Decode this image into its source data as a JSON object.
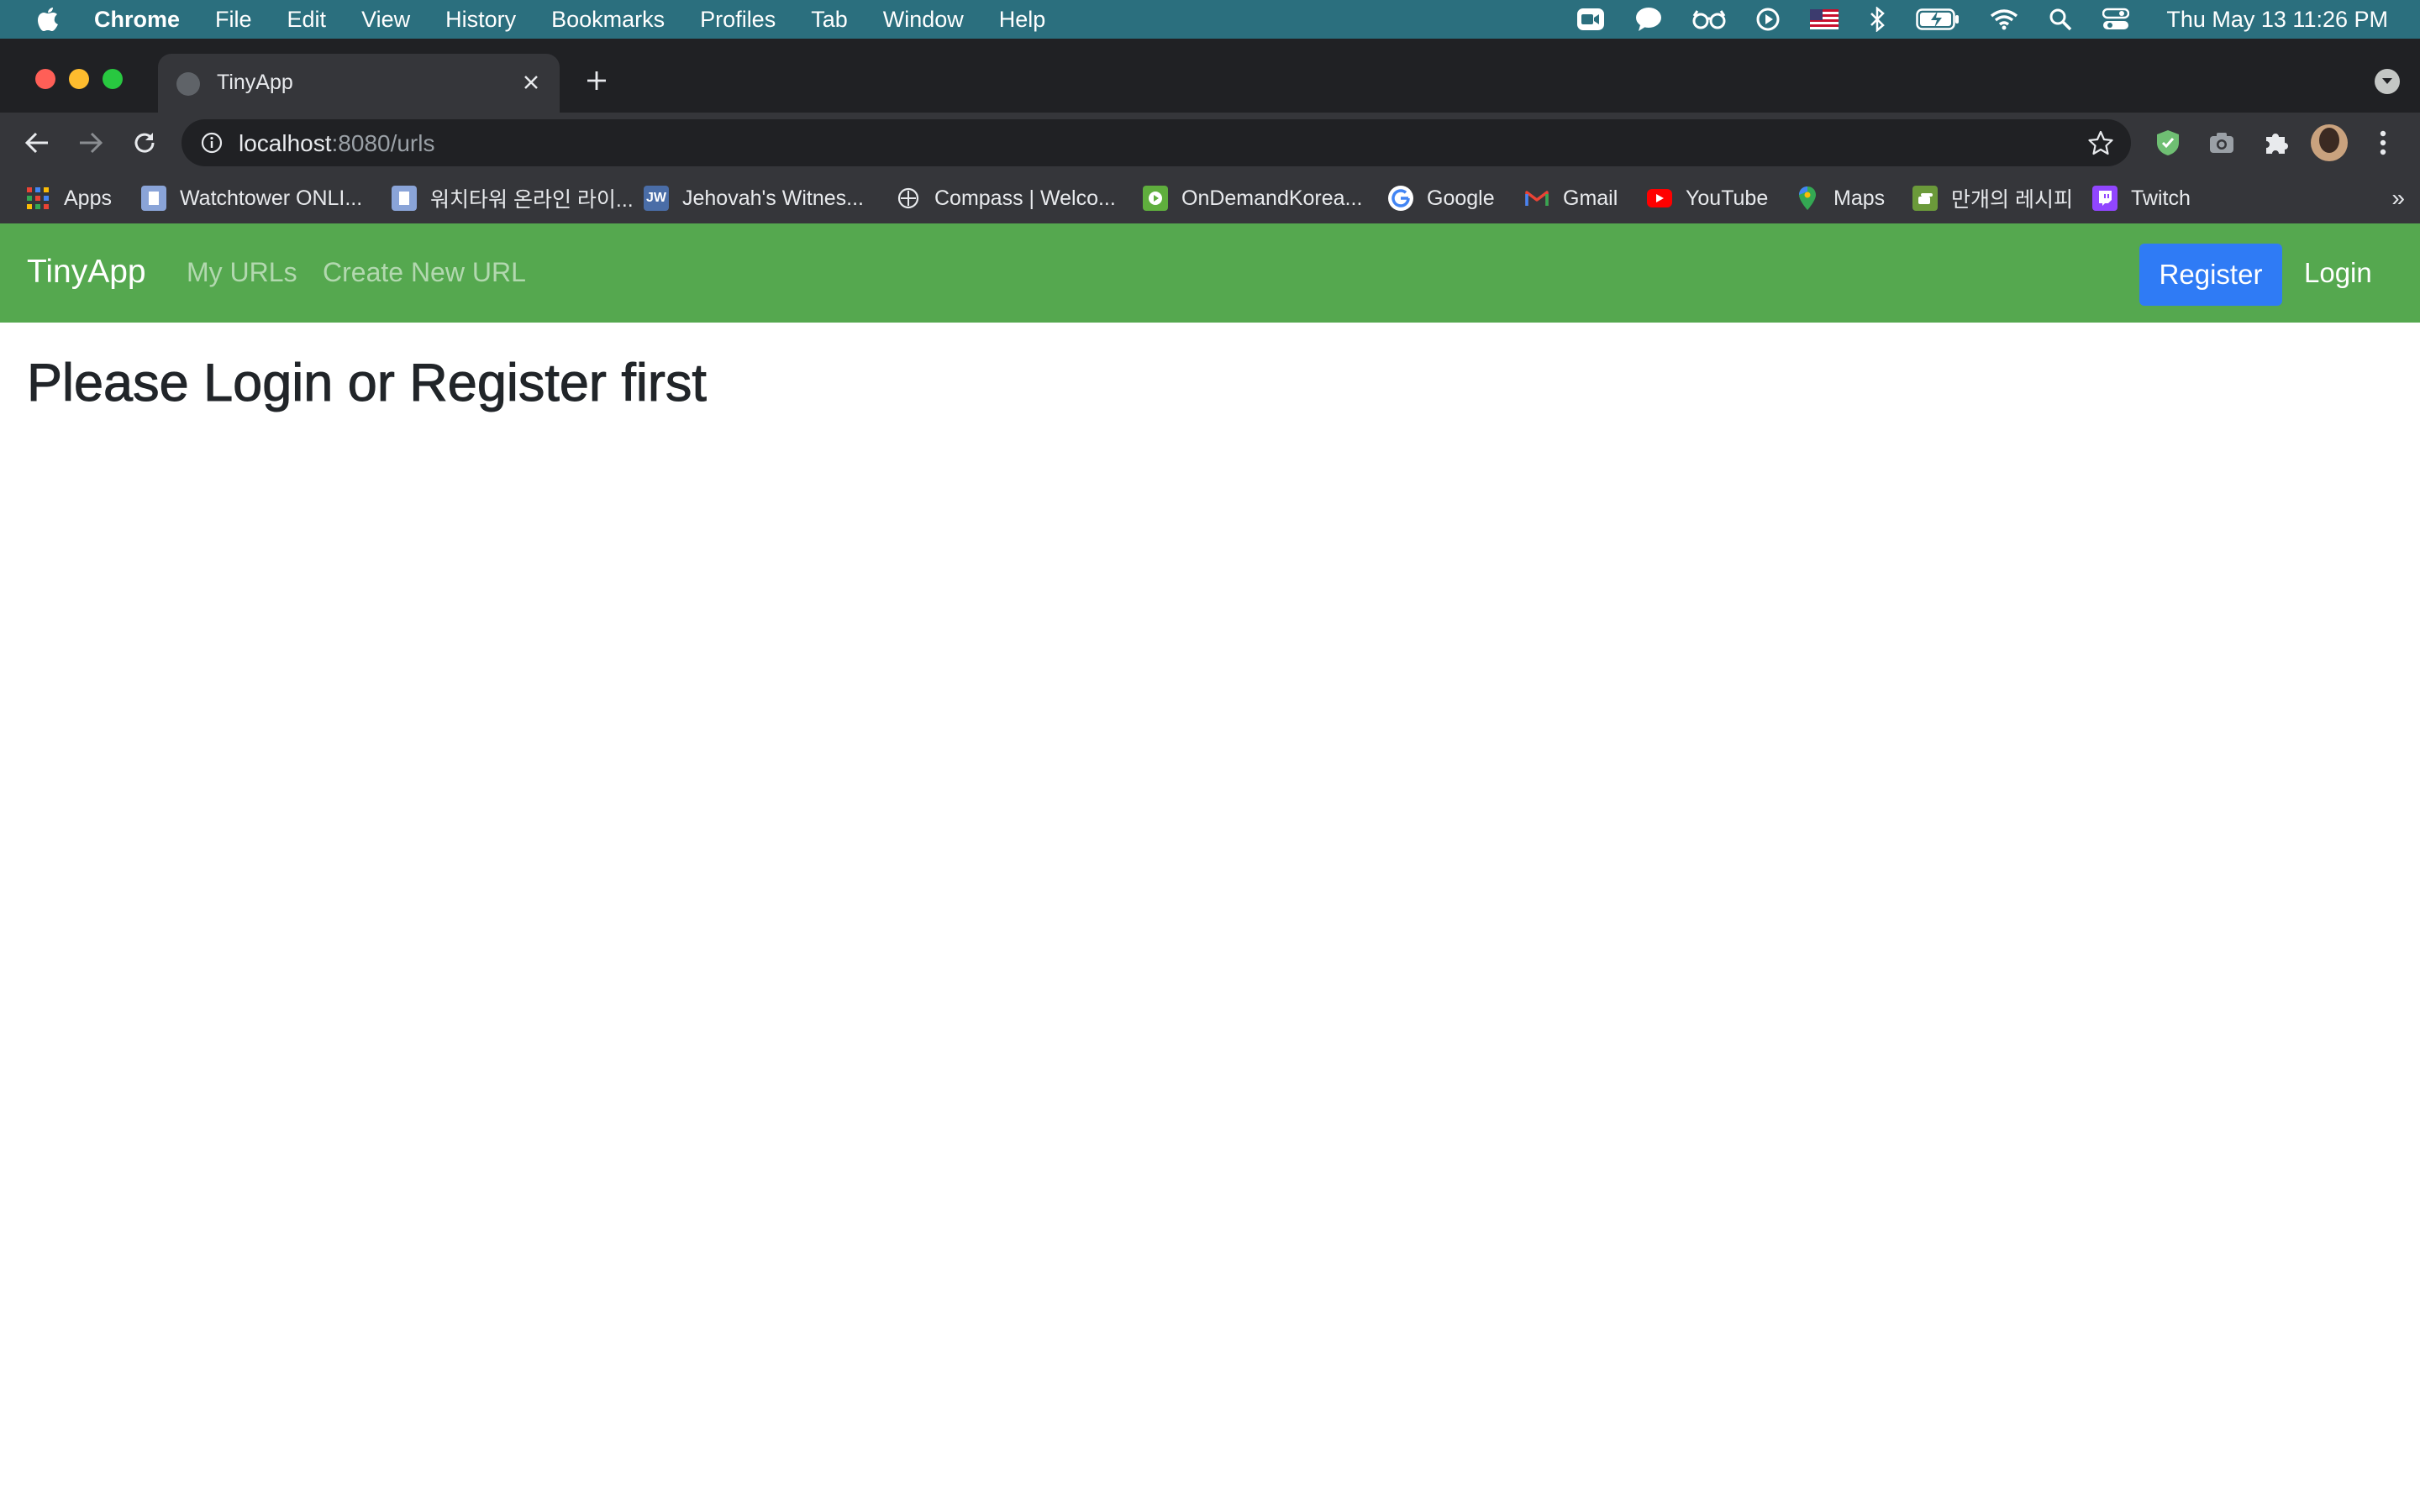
{
  "menubar": {
    "app_name": "Chrome",
    "items": [
      "File",
      "Edit",
      "View",
      "History",
      "Bookmarks",
      "Profiles",
      "Tab",
      "Window",
      "Help"
    ],
    "status_icons": [
      "zoom-icon",
      "messages-icon",
      "glasses-icon",
      "play-icon",
      "us-flag-icon",
      "bluetooth-icon",
      "battery-icon",
      "wifi-icon",
      "spotlight-icon",
      "control-center-icon"
    ],
    "clock": "Thu May 13  11:26 PM"
  },
  "browser": {
    "tab_title": "TinyApp",
    "url_host": "localhost",
    "url_rest": ":8080/urls",
    "bookmarks": [
      {
        "label": "Apps",
        "icon": "apps-grid-icon"
      },
      {
        "label": "Watchtower ONLI...",
        "icon": "watchtower-icon"
      },
      {
        "label": "워치타워 온라인 라이...",
        "icon": "watchtower-icon"
      },
      {
        "label": "Jehovah's Witnes...",
        "icon": "jw-icon",
        "icon_text": "JW"
      },
      {
        "label": "Compass | Welco...",
        "icon": "compass-icon"
      },
      {
        "label": "OnDemandKorea...",
        "icon": "ondemandkorea-icon"
      },
      {
        "label": "Google",
        "icon": "google-icon"
      },
      {
        "label": "Gmail",
        "icon": "gmail-icon"
      },
      {
        "label": "YouTube",
        "icon": "youtube-icon"
      },
      {
        "label": "Maps",
        "icon": "maps-icon"
      },
      {
        "label": "만개의 레시피",
        "icon": "recipe-icon"
      },
      {
        "label": "Twitch",
        "icon": "twitch-icon"
      }
    ],
    "bookmarks_more": "»"
  },
  "page": {
    "brand": "TinyApp",
    "nav_links": [
      "My URLs",
      "Create New URL"
    ],
    "register_label": "Register",
    "login_label": "Login",
    "heading": "Please Login or Register first"
  },
  "colors": {
    "menubar": "#2b6f7e",
    "navbar": "#55a84f",
    "register_button": "#2f7bf5",
    "heading_text": "#212529"
  }
}
